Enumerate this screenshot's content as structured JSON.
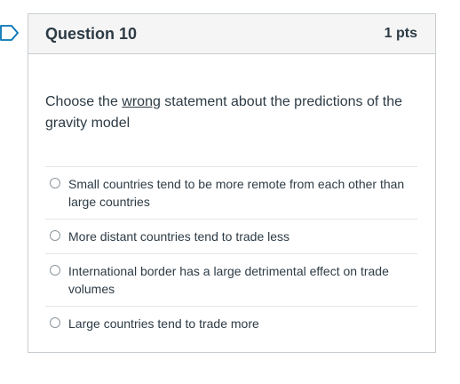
{
  "question": {
    "title": "Question 10",
    "points": "1 pts",
    "text_before": "Choose the ",
    "text_emphasis": "wrong",
    "text_after": " statement about the predictions of the gravity model"
  },
  "answers": [
    {
      "label": "Small countries tend to be more remote from each other than large countries",
      "selected": false
    },
    {
      "label": "More distant countries tend to trade less",
      "selected": false
    },
    {
      "label": "International border has a large detrimental effect on trade volumes",
      "selected": false
    },
    {
      "label": "Large countries tend to trade more",
      "selected": false
    }
  ],
  "colors": {
    "accent": "#0374b5",
    "text": "#2d3b45",
    "header_bg": "#f5f5f5",
    "border": "#c7cdd1"
  },
  "icons": {
    "flag": "flag-icon"
  }
}
